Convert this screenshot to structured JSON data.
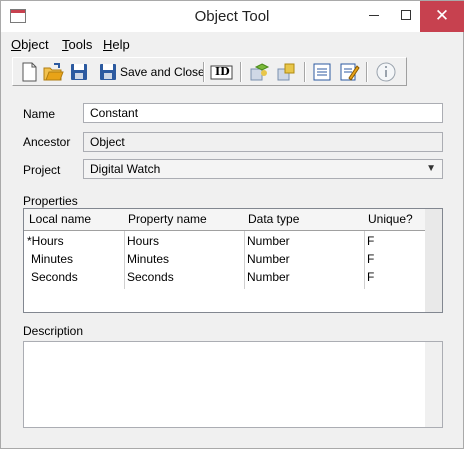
{
  "window": {
    "title": "Object Tool",
    "close_glyph": "✕"
  },
  "menu": {
    "items": [
      {
        "label": "Object",
        "accel": "O",
        "rest": "bject"
      },
      {
        "label": "Tools",
        "accel": "T",
        "rest": "ools"
      },
      {
        "label": "Help",
        "accel": "H",
        "rest": "elp"
      }
    ]
  },
  "toolbar": {
    "save_close_label": "Save and Close",
    "id_label": "ID",
    "icons": [
      "new-icon",
      "open-folder-icon",
      "save-icon",
      "save-and-close-icon",
      "id-icon",
      "tool-cube-icon",
      "tool-cube-alt-icon",
      "properties-list-icon",
      "edit-document-icon",
      "info-icon"
    ],
    "colors": {
      "folder": "#e8a317",
      "disk": "#2c5aa0",
      "green": "#7bb83a"
    }
  },
  "form": {
    "name_label": "Name",
    "name_value": "Constant",
    "ancestor_label": "Ancestor",
    "ancestor_value": "Object",
    "project_label": "Project",
    "project_value": "Digital Watch"
  },
  "properties": {
    "label": "Properties",
    "columns": [
      "Local name",
      "Property name",
      "Data type",
      "Unique?"
    ],
    "rows": [
      [
        "*Hours",
        "Hours",
        "Number",
        "F"
      ],
      [
        "Minutes",
        "Minutes",
        "Number",
        "F"
      ],
      [
        "Seconds",
        "Seconds",
        "Number",
        "F"
      ]
    ]
  },
  "description": {
    "label": "Description",
    "value": ""
  }
}
